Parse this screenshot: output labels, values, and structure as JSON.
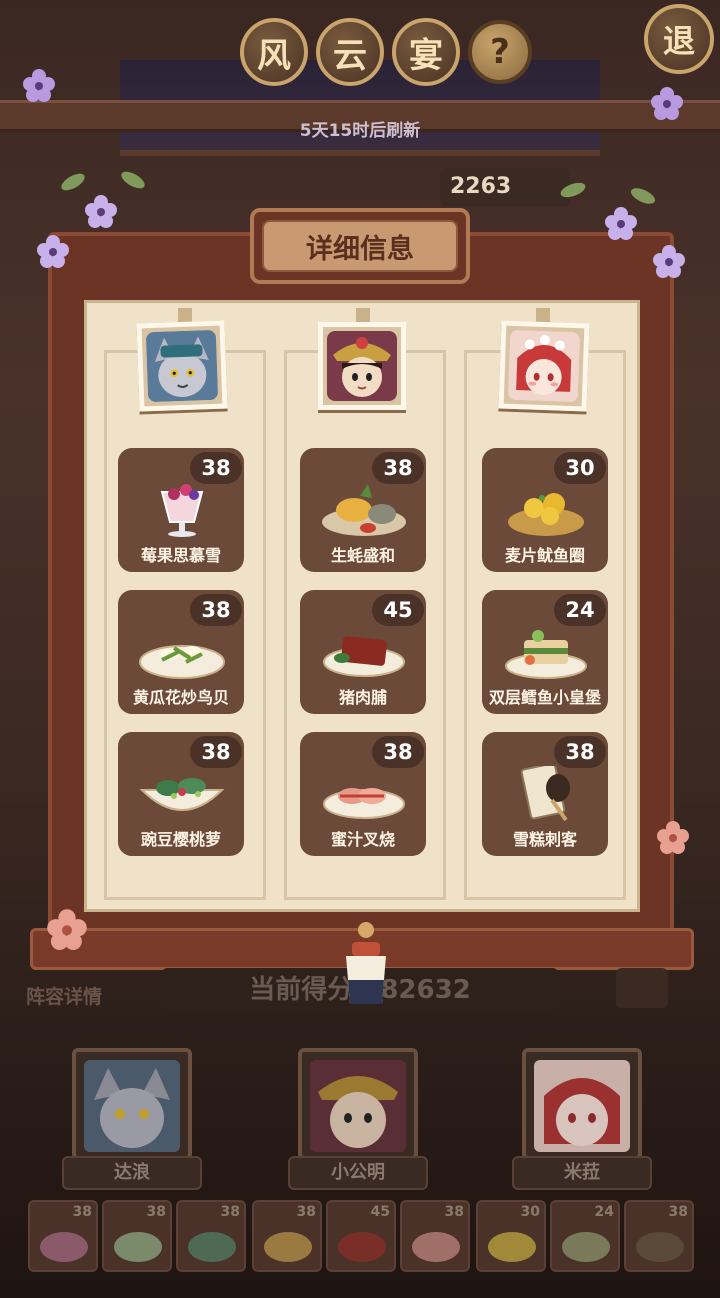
{
  "header": {
    "title_chars": [
      "风",
      "云",
      "宴"
    ],
    "help_label": "?",
    "exit_label": "退",
    "refresh_text": "5天15时后刷新",
    "score_partial": "2263"
  },
  "panel": {
    "title": "详细信息",
    "columns": [
      {
        "character_icon": "wolf-guard-portrait",
        "dishes": [
          {
            "name": "莓果思慕雪",
            "score": "38",
            "icon": "berry-smoothie-icon"
          },
          {
            "name": "黄瓜花炒鸟贝",
            "score": "38",
            "icon": "stirfry-clam-icon"
          },
          {
            "name": "豌豆樱桃萝",
            "score": "38",
            "icon": "pea-salad-icon"
          }
        ]
      },
      {
        "character_icon": "opera-general-portrait",
        "dishes": [
          {
            "name": "生蚝盛和",
            "score": "38",
            "icon": "oyster-platter-icon"
          },
          {
            "name": "猪肉脯",
            "score": "45",
            "icon": "jerky-icon"
          },
          {
            "name": "蜜汁叉烧",
            "score": "38",
            "icon": "char-siu-icon"
          }
        ]
      },
      {
        "character_icon": "opera-girl-portrait",
        "dishes": [
          {
            "name": "麦片鱿鱼圈",
            "score": "30",
            "icon": "squid-rings-icon"
          },
          {
            "name": "双层鳕鱼小皇堡",
            "score": "24",
            "icon": "cod-burger-icon"
          },
          {
            "name": "雪糕刺客",
            "score": "38",
            "icon": "ice-cream-icon"
          }
        ]
      }
    ]
  },
  "lower": {
    "lineup_label": "阵容详情",
    "current_score": "当前得分 982632",
    "team": [
      {
        "name": "达浪",
        "portrait": "wolf-guard-portrait"
      },
      {
        "name": "小公明",
        "portrait": "opera-general-portrait"
      },
      {
        "name": "米菈",
        "portrait": "opera-girl-portrait"
      }
    ],
    "dish_strip": [
      "38",
      "38",
      "38",
      "38",
      "45",
      "38",
      "30",
      "24",
      "38"
    ]
  },
  "colors": {
    "board": "#6b3425",
    "paper": "#efe2c8",
    "card": "#6b4a3a",
    "badge": "#4a3228"
  }
}
